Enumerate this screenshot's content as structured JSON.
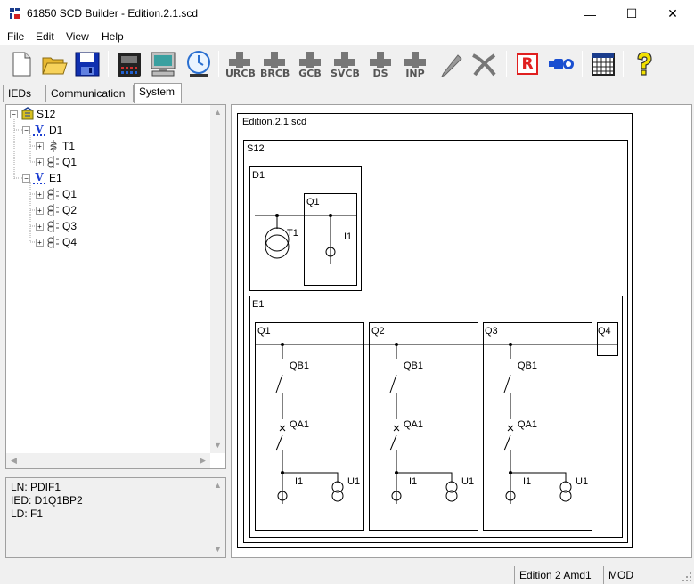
{
  "window": {
    "title": "61850 SCD Builder - Edition.2.1.scd",
    "minimize": "—",
    "maximize": "☐",
    "close": "✕"
  },
  "menu": [
    {
      "label": "File"
    },
    {
      "label": "Edit"
    },
    {
      "label": "View"
    },
    {
      "label": "Help"
    }
  ],
  "toolbar": {
    "buttons": [
      {
        "name": "new-file-icon"
      },
      {
        "name": "open-folder-icon"
      },
      {
        "name": "save-disk-icon"
      },
      {
        "name": "ied-device-icon"
      },
      {
        "name": "computer-icon"
      },
      {
        "name": "clock-icon"
      }
    ],
    "plus_buttons": [
      {
        "label": "URCB"
      },
      {
        "label": "BRCB"
      },
      {
        "label": "GCB"
      },
      {
        "label": "SVCB"
      },
      {
        "label": "DS"
      },
      {
        "label": "INP"
      }
    ],
    "r_label": "R"
  },
  "tabs": [
    {
      "label": "IEDs",
      "active": false
    },
    {
      "label": "Communication",
      "active": false
    },
    {
      "label": "System",
      "active": true
    }
  ],
  "tree": {
    "root": {
      "label": "S12",
      "expander": "−"
    },
    "voltage_marker": "V",
    "nodes": [
      {
        "label": "D1",
        "type": "voltage",
        "expander": "−"
      },
      {
        "label": "T1",
        "type": "transformer",
        "expander": "+"
      },
      {
        "label": "Q1",
        "type": "bay",
        "expander": "+"
      },
      {
        "label": "E1",
        "type": "voltage",
        "expander": "−"
      },
      {
        "label": "Q1",
        "type": "bay",
        "expander": "+"
      },
      {
        "label": "Q2",
        "type": "bay",
        "expander": "+"
      },
      {
        "label": "Q3",
        "type": "bay",
        "expander": "+"
      },
      {
        "label": "Q4",
        "type": "bay",
        "expander": "+"
      }
    ]
  },
  "info": {
    "ln": "LN: PDIF1",
    "ied": "IED: D1Q1BP2",
    "ld": "LD: F1"
  },
  "diagram": {
    "file_label": "Edition.2.1.scd",
    "substation_label": "S12",
    "d1": {
      "label": "D1",
      "bay_label": "Q1",
      "transformer_label": "T1",
      "ct_label": "I1"
    },
    "e1": {
      "label": "E1",
      "bays": [
        {
          "label": "Q1",
          "qb": "QB1",
          "qa": "QA1",
          "ct": "I1",
          "vt": "U1"
        },
        {
          "label": "Q2",
          "qb": "QB1",
          "qa": "QA1",
          "ct": "I1",
          "vt": "U1"
        },
        {
          "label": "Q3",
          "qb": "QB1",
          "qa": "QA1",
          "ct": "I1",
          "vt": "U1"
        }
      ],
      "empty_bay_label": "Q4"
    }
  },
  "status": {
    "edition": "Edition 2 Amd1",
    "mode": "MOD"
  },
  "scroll_arrows": {
    "up": "▲",
    "down": "▼",
    "left": "◀",
    "right": "▶"
  }
}
